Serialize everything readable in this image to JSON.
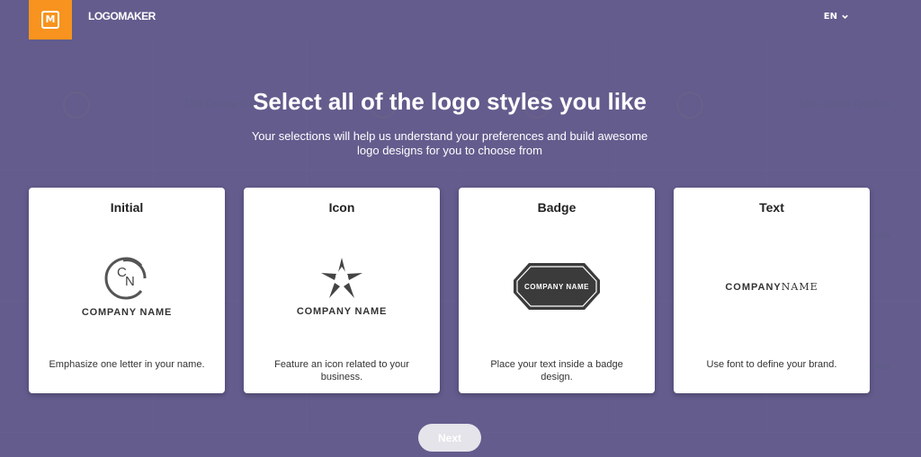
{
  "header": {
    "brand": "LOGOMAKER",
    "logo_letter": "M",
    "language": "EN"
  },
  "main": {
    "title": "Select all of the logo styles you like",
    "subtitle": "Your selections will help us understand your preferences and build awesome logo designs for you to choose from"
  },
  "background_samples": [
    "The Green Garden",
    "The Green Garden",
    "The Green Garden",
    "The Green Garden",
    "The Green Garden",
    "The Green Garden"
  ],
  "cards": [
    {
      "title": "Initial",
      "initials": "CN",
      "company": "COMPANY NAME",
      "description": "Emphasize one letter in your name."
    },
    {
      "title": "Icon",
      "company": "COMPANY NAME",
      "description": "Feature an icon related to your business."
    },
    {
      "title": "Badge",
      "company": "COMPANY NAME",
      "description": "Place your text inside a badge design."
    },
    {
      "title": "Text",
      "company_bold": "COMPANY",
      "company_light": "NAME",
      "description": "Use font to define your brand."
    }
  ],
  "footer": {
    "next_label": "Next"
  },
  "colors": {
    "accent": "#f7931e",
    "background": "#6b6490",
    "button_disabled": "#e4e4ea"
  }
}
